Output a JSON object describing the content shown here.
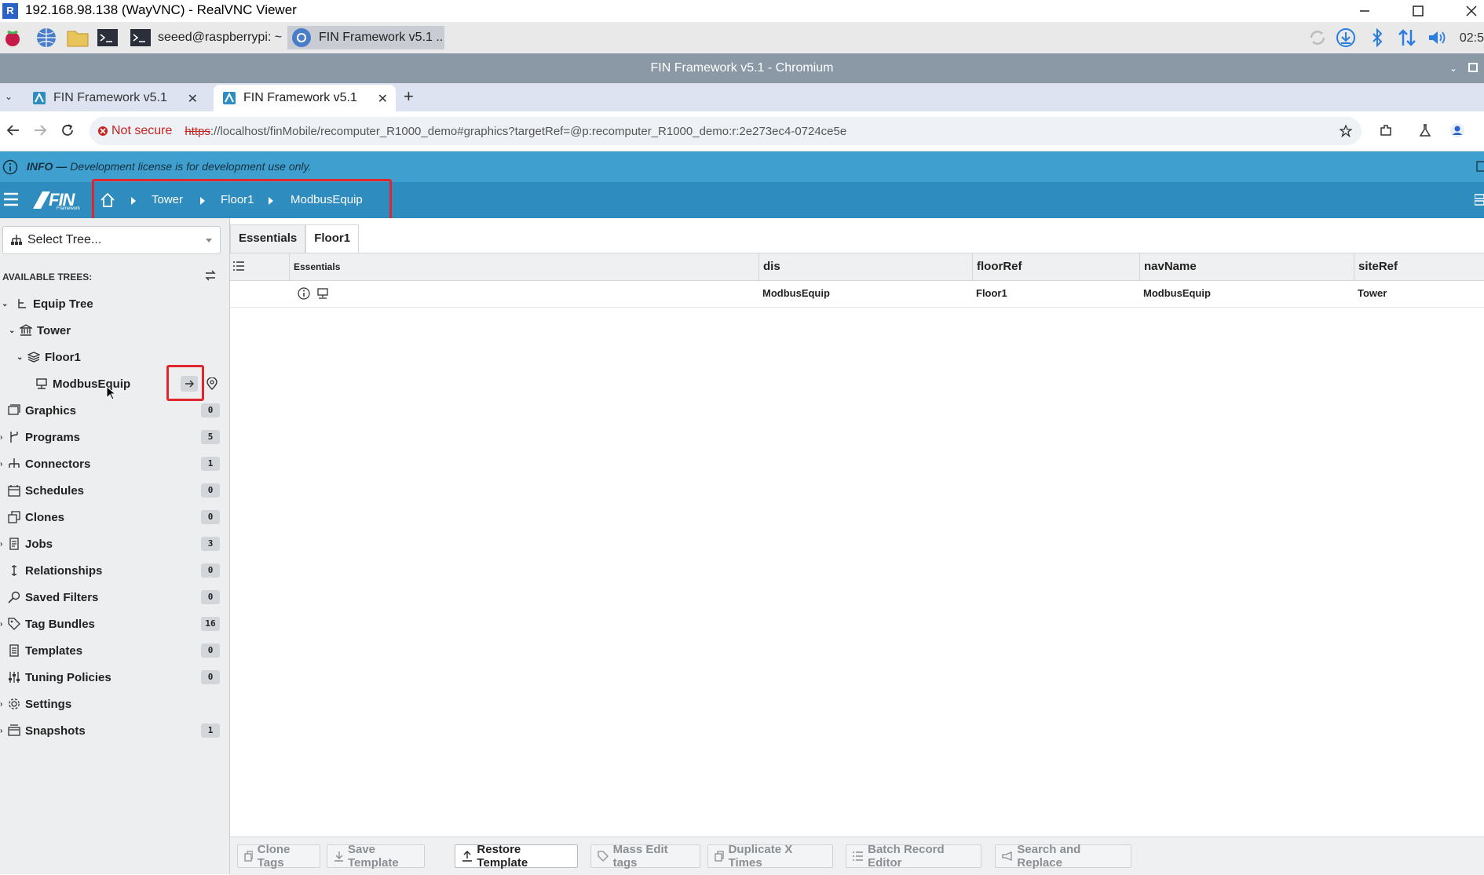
{
  "vnc": {
    "title": "192.168.98.138 (WayVNC) - RealVNC Viewer",
    "logo_text": "R"
  },
  "taskbar": {
    "terminal_task": "seeed@raspberrypi: ~",
    "browser_task": "FIN Framework v5.1 ..",
    "clock": "02:5"
  },
  "browser": {
    "window_title": "FIN Framework v5.1 - Chromium",
    "tabs": [
      {
        "label": "FIN Framework v5.1",
        "close": "✕"
      },
      {
        "label": "FIN Framework v5.1",
        "close": "✕"
      }
    ],
    "new_tab": "+",
    "not_secure": "Not secure",
    "url_scheme": "https",
    "url_rest": "://localhost/finMobile/recomputer_R1000_demo#graphics?targetRef=@p:recomputer_R1000_demo:r:2e273ec4-0724ce5e"
  },
  "info_banner": {
    "label": "INFO —",
    "text": " Development license is for development use only."
  },
  "fin_header": {
    "logo": "FIN",
    "logo_sub": "Framework",
    "breadcrumbs": [
      "Tower",
      "Floor1",
      "ModbusEquip"
    ]
  },
  "sidebar": {
    "select_tree": "Select Tree...",
    "available_trees_title": "AVAILABLE TREES:",
    "equip_tree": "Equip Tree",
    "tower": "Tower",
    "floor1": "Floor1",
    "modbus_equip": "ModbusEquip",
    "items": [
      {
        "label": "Graphics",
        "count": "0"
      },
      {
        "label": "Programs",
        "count": "5"
      },
      {
        "label": "Connectors",
        "count": "1"
      },
      {
        "label": "Schedules",
        "count": "0"
      },
      {
        "label": "Clones",
        "count": "0"
      },
      {
        "label": "Jobs",
        "count": "3"
      },
      {
        "label": "Relationships",
        "count": "0"
      },
      {
        "label": "Saved Filters",
        "count": "0"
      },
      {
        "label": "Tag Bundles",
        "count": "16"
      },
      {
        "label": "Templates",
        "count": "0"
      },
      {
        "label": "Tuning Policies",
        "count": "0"
      },
      {
        "label": "Settings",
        "count": ""
      },
      {
        "label": "Snapshots",
        "count": "1"
      }
    ]
  },
  "main": {
    "tabs": [
      "Essentials",
      "Floor1"
    ],
    "columns": [
      "Essentials",
      "dis",
      "floorRef",
      "navName",
      "siteRef"
    ],
    "row": {
      "dis": "ModbusEquip",
      "floorRef": "Floor1",
      "navName": "ModbusEquip",
      "siteRef": "Tower"
    }
  },
  "toolbar": {
    "clone_tags": "Clone Tags",
    "save_template": "Save Template",
    "restore_template": "Restore Template",
    "mass_edit_tags": "Mass Edit tags",
    "duplicate_x_times": "Duplicate X Times",
    "batch_record_editor": "Batch Record Editor",
    "search_and_replace": "Search and Replace"
  }
}
